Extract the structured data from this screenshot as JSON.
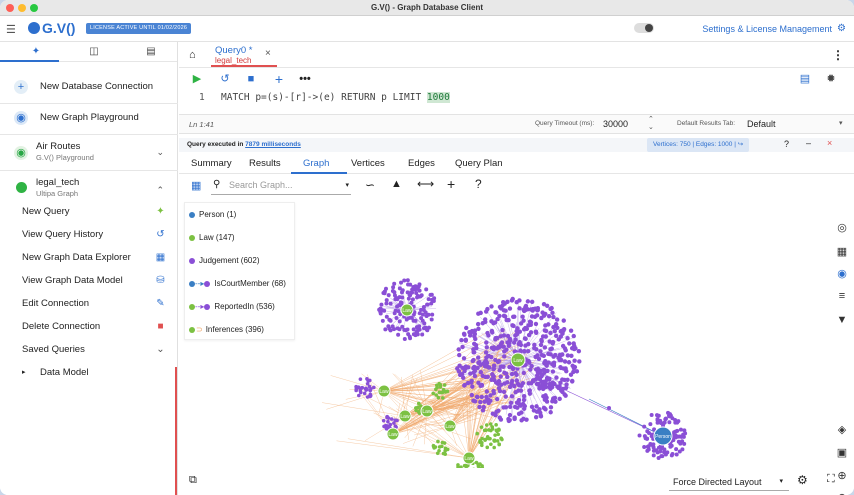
{
  "window": {
    "title": "G.V() - Graph Database Client"
  },
  "header": {
    "logo": "G.V()",
    "license_badge": "LICENSE ACTIVE UNTIL 01/02/2026",
    "settings_link": "Settings & License Management"
  },
  "sidebar": {
    "new_connection": "New Database Connection",
    "new_playground": "New Graph Playground",
    "air_routes": {
      "title": "Air Routes",
      "subtitle": "G.V() Playground"
    },
    "legal_tech": {
      "title": "legal_tech",
      "subtitle": "Ultipa Graph"
    },
    "items": [
      {
        "label": "New Query",
        "icon": "magic-wand-icon"
      },
      {
        "label": "View Query History",
        "icon": "history-icon"
      },
      {
        "label": "New Graph Data Explorer",
        "icon": "explorer-icon"
      },
      {
        "label": "View Graph Data Model",
        "icon": "database-icon"
      },
      {
        "label": "Edit Connection",
        "icon": "edit-icon"
      },
      {
        "label": "Delete Connection",
        "icon": "trash-icon"
      },
      {
        "label": "Saved Queries",
        "icon": "chevron-down-icon"
      }
    ],
    "data_model": "Data Model"
  },
  "query_tab": {
    "name": "Query0 *",
    "connection": "legal_tech"
  },
  "editor": {
    "line_number": "1",
    "code_before": "MATCH p=(s)-[r]->(e) RETURN p LIMIT ",
    "code_highlight": "1000"
  },
  "status": {
    "position": "Ln 1:41",
    "timeout_label": "Query Timeout (ms):",
    "timeout_value": "30000",
    "default_tab_label": "Default Results Tab:",
    "default_tab_value": "Default"
  },
  "execution": {
    "prefix": "Query executed in ",
    "time": "7879 milliseconds",
    "vertices": "Vertices: 750",
    "edges": "Edges: 1000"
  },
  "result_tabs": [
    "Summary",
    "Results",
    "Graph",
    "Vertices",
    "Edges",
    "Query Plan"
  ],
  "active_result_tab": "Graph",
  "graph": {
    "search_placeholder": "Search Graph...",
    "legend": [
      {
        "label": "Person (1)",
        "color": "#3a7fc4",
        "kind": "node"
      },
      {
        "label": "Law (147)",
        "color": "#7cc142",
        "kind": "node"
      },
      {
        "label": "Judgement (602)",
        "color": "#8a4fd6",
        "kind": "node"
      },
      {
        "label": "IsCourtMember (68)",
        "color": "#3a7fc4",
        "kind": "edge"
      },
      {
        "label": "ReportedIn (536)",
        "color": "#8a4fd6",
        "kind": "edge"
      },
      {
        "label": "Inferences (396)",
        "color": "#f0a86c",
        "kind": "edge"
      }
    ],
    "node_labels": {
      "law": "Law",
      "person": "Person"
    },
    "layout": "Force Directed Layout"
  },
  "colors": {
    "accent": "#2d6fce",
    "law": "#7cc142",
    "judgement": "#8a4fd6",
    "person": "#3a7fc4",
    "inference": "#f0a86c"
  }
}
